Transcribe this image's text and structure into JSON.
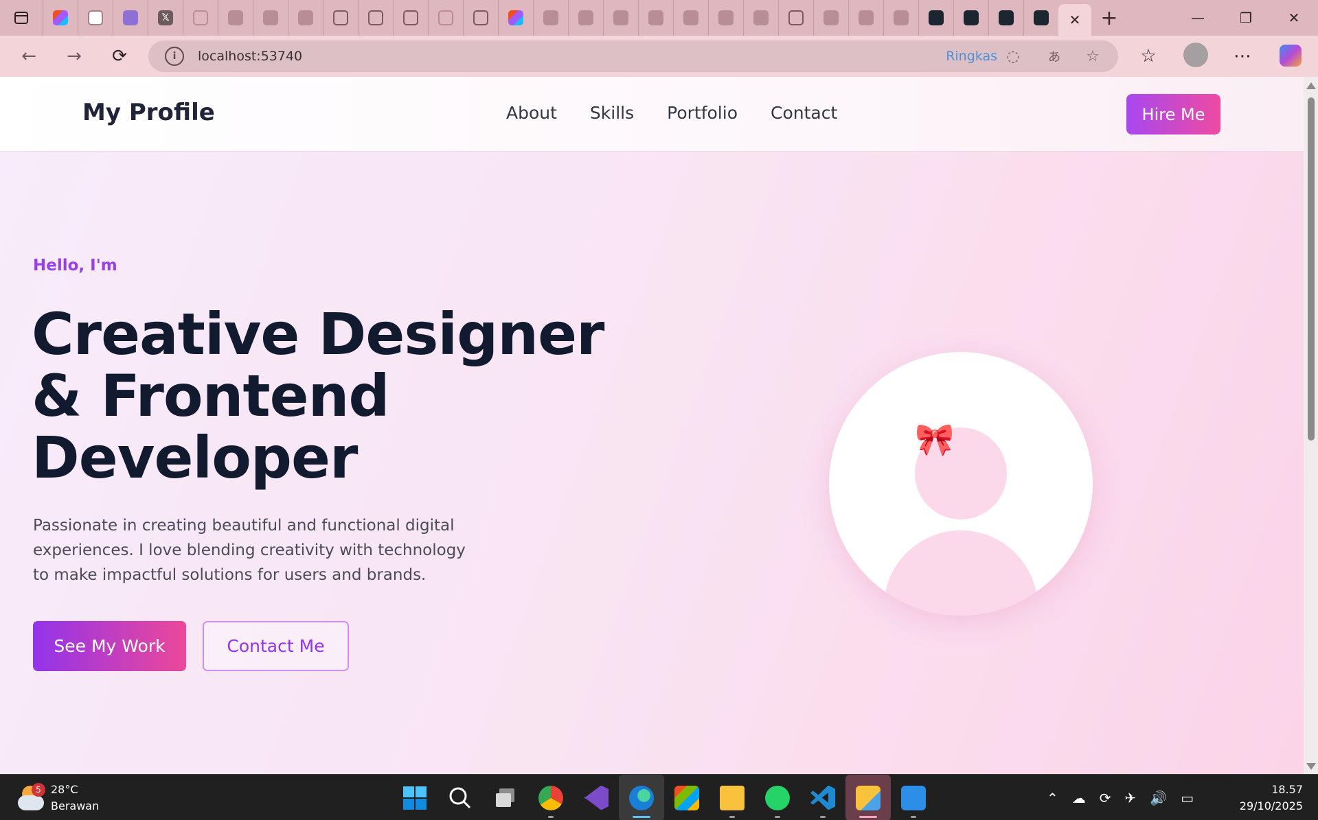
{
  "browser": {
    "url": "localhost:53740",
    "ringkas_label": "Ringkas",
    "window_controls": {
      "minimize": "—",
      "restore": "❐",
      "close": "✕"
    },
    "tabs": [
      {
        "icon": "figma-icon"
      },
      {
        "icon": "github-icon"
      },
      {
        "icon": "discord-icon"
      },
      {
        "icon": "x-icon"
      },
      {
        "icon": "chatgpt-icon"
      },
      {
        "icon": "react-icon"
      },
      {
        "icon": "react-icon"
      },
      {
        "icon": "react-icon"
      },
      {
        "icon": "globe-icon"
      },
      {
        "icon": "globe-icon"
      },
      {
        "icon": "globe-icon"
      },
      {
        "icon": "chatgpt-icon"
      },
      {
        "icon": "globe-icon"
      },
      {
        "icon": "figma-icon"
      },
      {
        "icon": "react-icon"
      },
      {
        "icon": "react-icon"
      },
      {
        "icon": "react-icon"
      },
      {
        "icon": "react-icon"
      },
      {
        "icon": "react-icon"
      },
      {
        "icon": "react-icon"
      },
      {
        "icon": "react-icon"
      },
      {
        "icon": "globe-icon"
      },
      {
        "icon": "react-icon"
      },
      {
        "icon": "react-icon"
      },
      {
        "icon": "react-icon"
      },
      {
        "icon": "react-dark-icon"
      },
      {
        "icon": "react-dark-icon"
      },
      {
        "icon": "react-dark-icon"
      },
      {
        "icon": "react-dark-icon"
      }
    ]
  },
  "site": {
    "brand": "My Profile",
    "nav": [
      "About",
      "Skills",
      "Portfolio",
      "Contact"
    ],
    "hire_button": "Hire Me",
    "hero": {
      "greeting": "Hello, I'm",
      "headline_line1": "Creative Designer",
      "headline_line2": "& Frontend",
      "headline_line3": "Developer",
      "description": "Passionate in creating beautiful and functional digital experiences. I love blending creativity with technology to make impactful solutions for users and brands.",
      "primary_button": "See My Work",
      "secondary_button": "Contact Me",
      "avatar_bow": "🎀"
    },
    "colors": {
      "accent_purple": "#9333ea",
      "accent_pink": "#ec4899",
      "heading": "#121a30"
    }
  },
  "taskbar": {
    "weather": {
      "temp": "28°C",
      "condition": "Berawan",
      "badge": "5"
    },
    "time": "18.57",
    "date": "29/10/2025"
  }
}
